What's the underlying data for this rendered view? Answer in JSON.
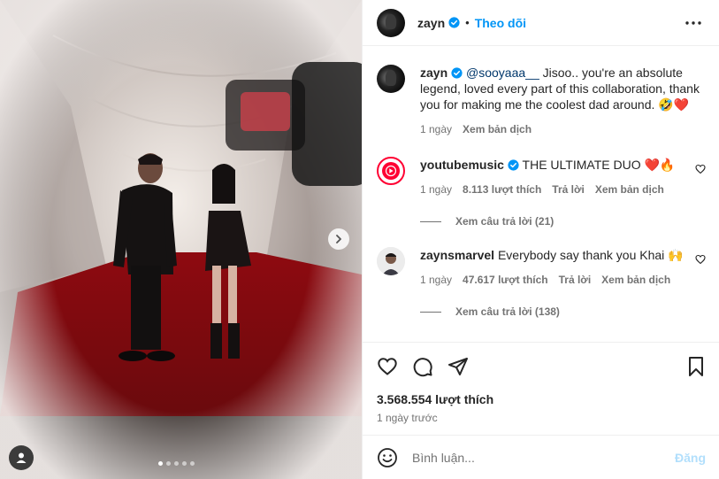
{
  "post": {
    "author": "zayn",
    "follow_label": "Theo dõi",
    "separator": "•",
    "caption": {
      "username": "zayn",
      "mention": "@sooyaaa__",
      "text": " Jisoo.. you're an absolute legend, loved every part of this collaboration, thank you for making me the coolest dad around. ",
      "emojis": "🤣❤️",
      "time": "1 ngày",
      "translate": "Xem bản dịch"
    },
    "comments": [
      {
        "username": "youtubemusic",
        "text": " THE ULTIMATE DUO ",
        "emojis": "❤️🔥",
        "time": "1 ngày",
        "likes": "8.113 lượt thích",
        "reply": "Trả lời",
        "translate": "Xem bản dịch",
        "view_replies": "Xem câu trả lời (21)"
      },
      {
        "username": "zaynsmarvel",
        "text": " Everybody say thank you Khai ",
        "emojis": "🙌",
        "time": "1 ngày",
        "likes": "47.617 lượt thích",
        "reply": "Trả lời",
        "translate": "Xem bản dịch",
        "view_replies": "Xem câu trả lời (138)"
      }
    ],
    "like_count": "3.568.554 lượt thích",
    "posted": "1 ngày trước",
    "add_comment_placeholder": "Bình luận...",
    "post_button": "Đăng"
  },
  "icons": {
    "verified": "verified-badge-icon",
    "more": "more-options-icon",
    "like": "heart-icon",
    "comment": "comment-icon",
    "share": "share-icon",
    "save": "bookmark-icon",
    "emoji": "emoji-icon",
    "next": "chevron-right-icon",
    "tagged_user": "user-tag-icon"
  },
  "carousel": {
    "slides": 5,
    "active": 1
  },
  "colors": {
    "accent": "#0095f6",
    "verified": "#0095f6",
    "heart": "#ed4956",
    "youtube": "#ff0033",
    "post_disabled": "#b2dffc"
  }
}
